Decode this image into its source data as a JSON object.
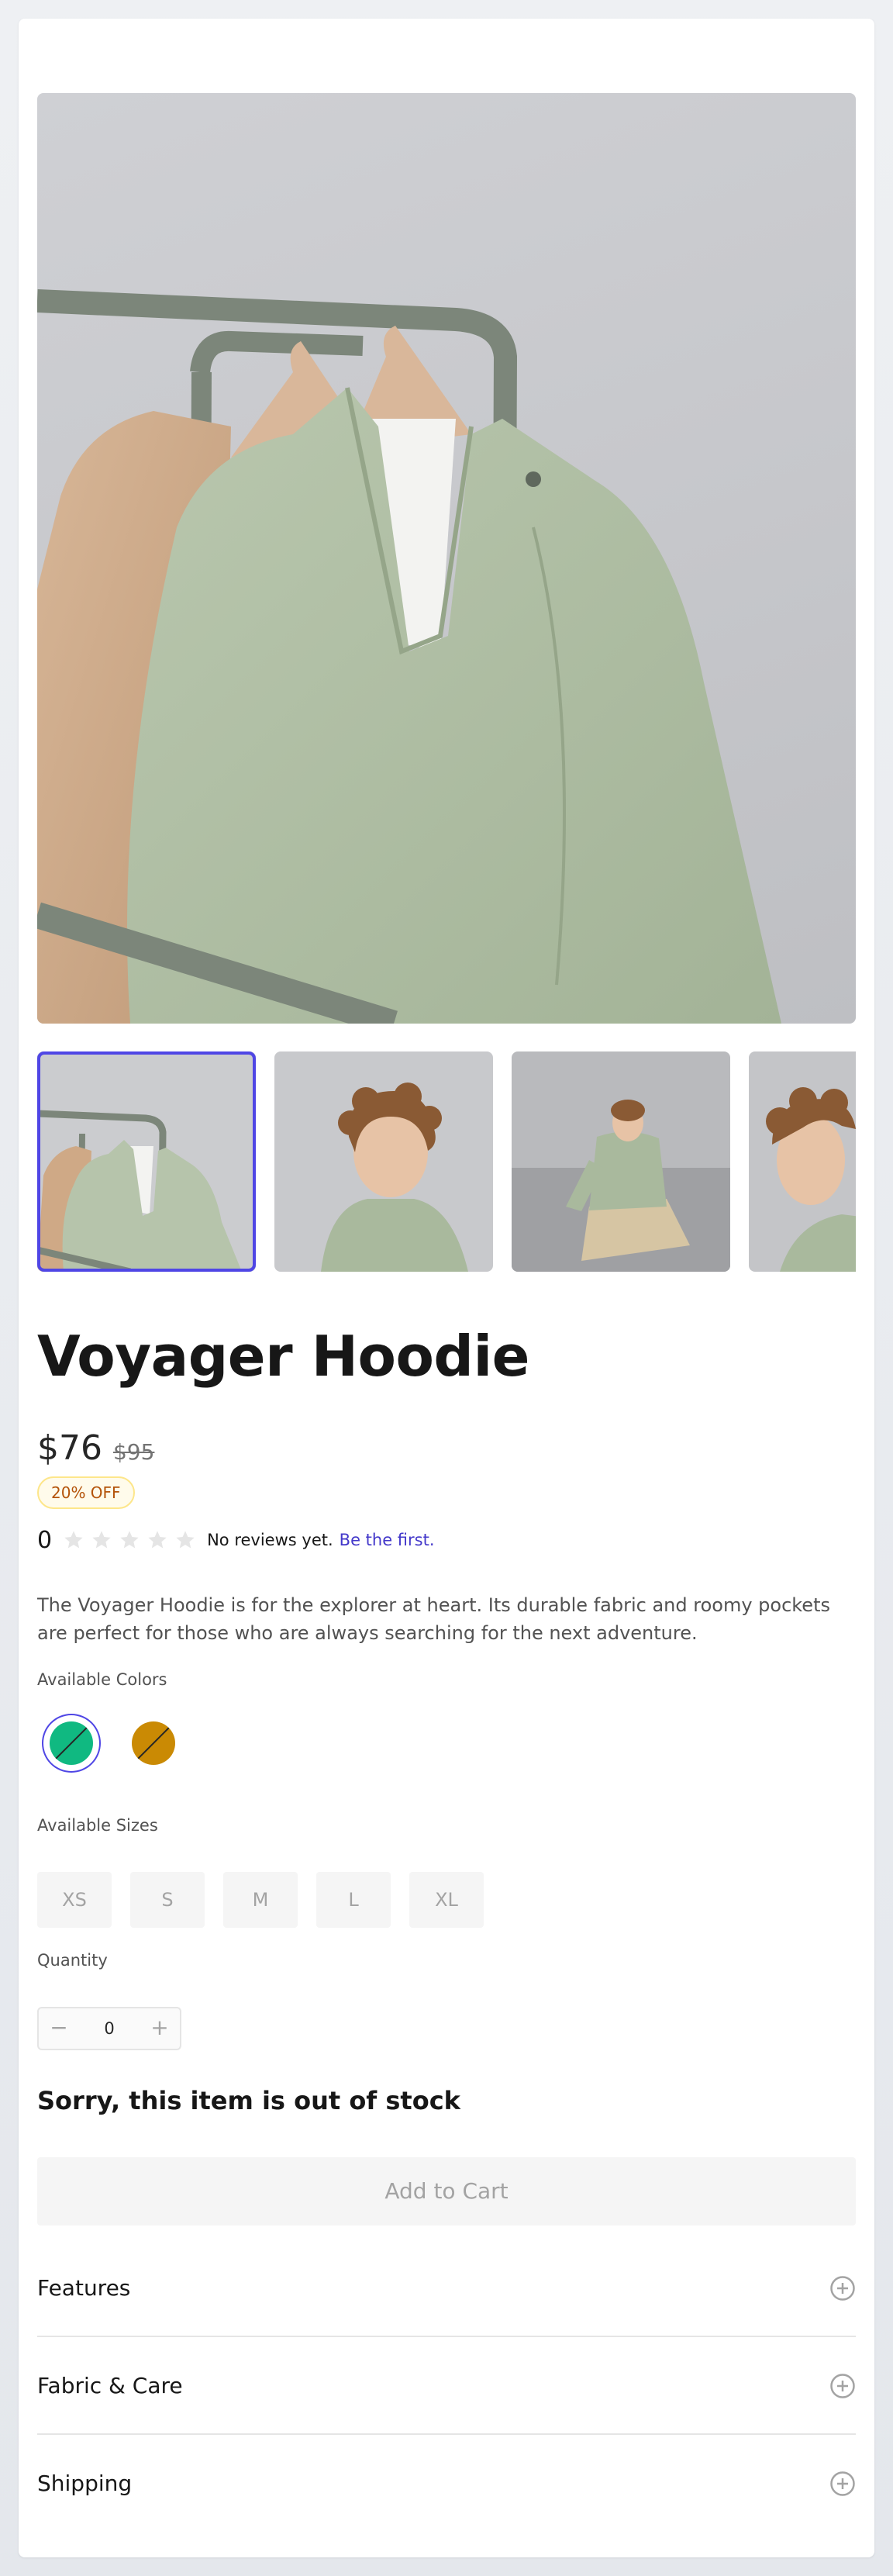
{
  "product": {
    "title": "Voyager Hoodie",
    "price": "$76",
    "list_price": "$95",
    "discount": "20% OFF",
    "rating_value": "0",
    "stars_filled": 0,
    "stars_total": 5,
    "review_text": "No reviews yet.",
    "review_link": "Be the first.",
    "description": "The Voyager Hoodie is for the explorer at heart. Its durable fabric and roomy pockets are perfect for those who are always searching for the next adventure."
  },
  "gallery": {
    "main_image": "green-hoodie-on-rack-image",
    "thumbnails": [
      {
        "image": "hoodie-on-rack-thumbnail",
        "selected": true
      },
      {
        "image": "model-portrait-thumbnail",
        "selected": false
      },
      {
        "image": "model-seated-thumbnail",
        "selected": false
      },
      {
        "image": "model-profile-thumbnail",
        "selected": false
      }
    ]
  },
  "colors": {
    "label": "Available Colors",
    "options": [
      {
        "name": "green",
        "hex": "#10b981",
        "selected": true,
        "available": false
      },
      {
        "name": "amber",
        "hex": "#ca8a04",
        "selected": false,
        "available": false
      }
    ]
  },
  "sizes": {
    "label": "Available Sizes",
    "options": [
      "XS",
      "S",
      "M",
      "L",
      "XL"
    ]
  },
  "quantity": {
    "label": "Quantity",
    "value": "0",
    "decrement": "−",
    "increment": "+"
  },
  "stock": {
    "message": "Sorry, this item is out of stock"
  },
  "cart": {
    "add_label": "Add to Cart"
  },
  "accordion": [
    {
      "label": "Features"
    },
    {
      "label": "Fabric & Care"
    },
    {
      "label": "Shipping"
    }
  ],
  "colors_theme": {
    "accent": "#4f46e5",
    "link": "#4338ca",
    "badge_text": "#b45309",
    "badge_border": "#fde68a"
  }
}
